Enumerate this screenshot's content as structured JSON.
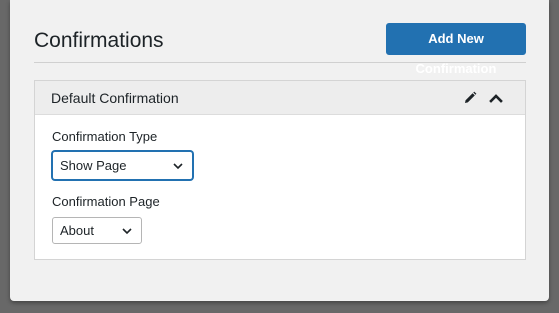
{
  "header": {
    "title": "Confirmations",
    "add_button_label": "Add New Confirmation"
  },
  "confirmation": {
    "title": "Default Confirmation",
    "type_field": {
      "label": "Confirmation Type",
      "selected_value": "Show Page"
    },
    "page_field": {
      "label": "Confirmation Page",
      "selected_value": "About"
    }
  },
  "icons": {
    "edit": "pencil-icon",
    "collapse": "chevron-up-icon",
    "dropdown": "chevron-down-icon"
  },
  "colors": {
    "primary": "#2271b1",
    "text": "#1d2327",
    "background": "#f1f1f1",
    "card_header": "#ededed"
  }
}
